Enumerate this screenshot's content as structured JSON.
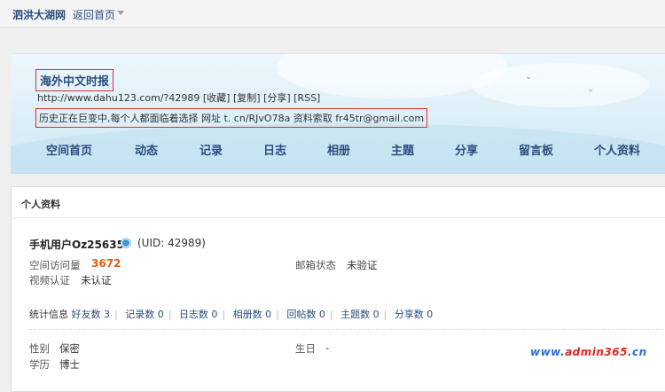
{
  "topbar": {
    "site_name": "泗洪大湖网",
    "home_link": "返回首页"
  },
  "banner": {
    "space_title": "海外中文时报",
    "url": "http://www.dahu123.com/?42989",
    "actions": [
      "[收藏]",
      "[复制]",
      "[分享]",
      "[RSS]"
    ],
    "motto": "历史正在巨变中,每个人都面临着选择 网址 t. cn/RJvO78a 资料索取 fr45tr@gmail.com"
  },
  "nav": [
    "空间首页",
    "动态",
    "记录",
    "日志",
    "相册",
    "主题",
    "分享",
    "留言板",
    "个人资料"
  ],
  "profile": {
    "panel_title": "个人资料",
    "username": "手机用户Oz25635",
    "uid_text": "(UID: 42989)",
    "visits_label": "空间访问量",
    "visits_value": "3672",
    "email_label": "邮箱状态",
    "email_value": "未验证",
    "video_label": "视频认证",
    "video_value": "未认证",
    "stats_label": "统计信息",
    "stats": [
      "好友数 3",
      "记录数 0",
      "日志数 0",
      "相册数 0",
      "回帖数 0",
      "主题数 0",
      "分享数 0"
    ],
    "gender_label": "性别",
    "gender_value": "保密",
    "birthday_label": "生日",
    "birthday_value": "-",
    "education_label": "学历",
    "education_value": "博士"
  },
  "watermark": {
    "part1": "www.",
    "part2": "admin365",
    "part3": ".cn"
  },
  "colors": {
    "link": "#2b4c7e",
    "accent": "#e65b15",
    "highlight_box": "#d8302c"
  }
}
